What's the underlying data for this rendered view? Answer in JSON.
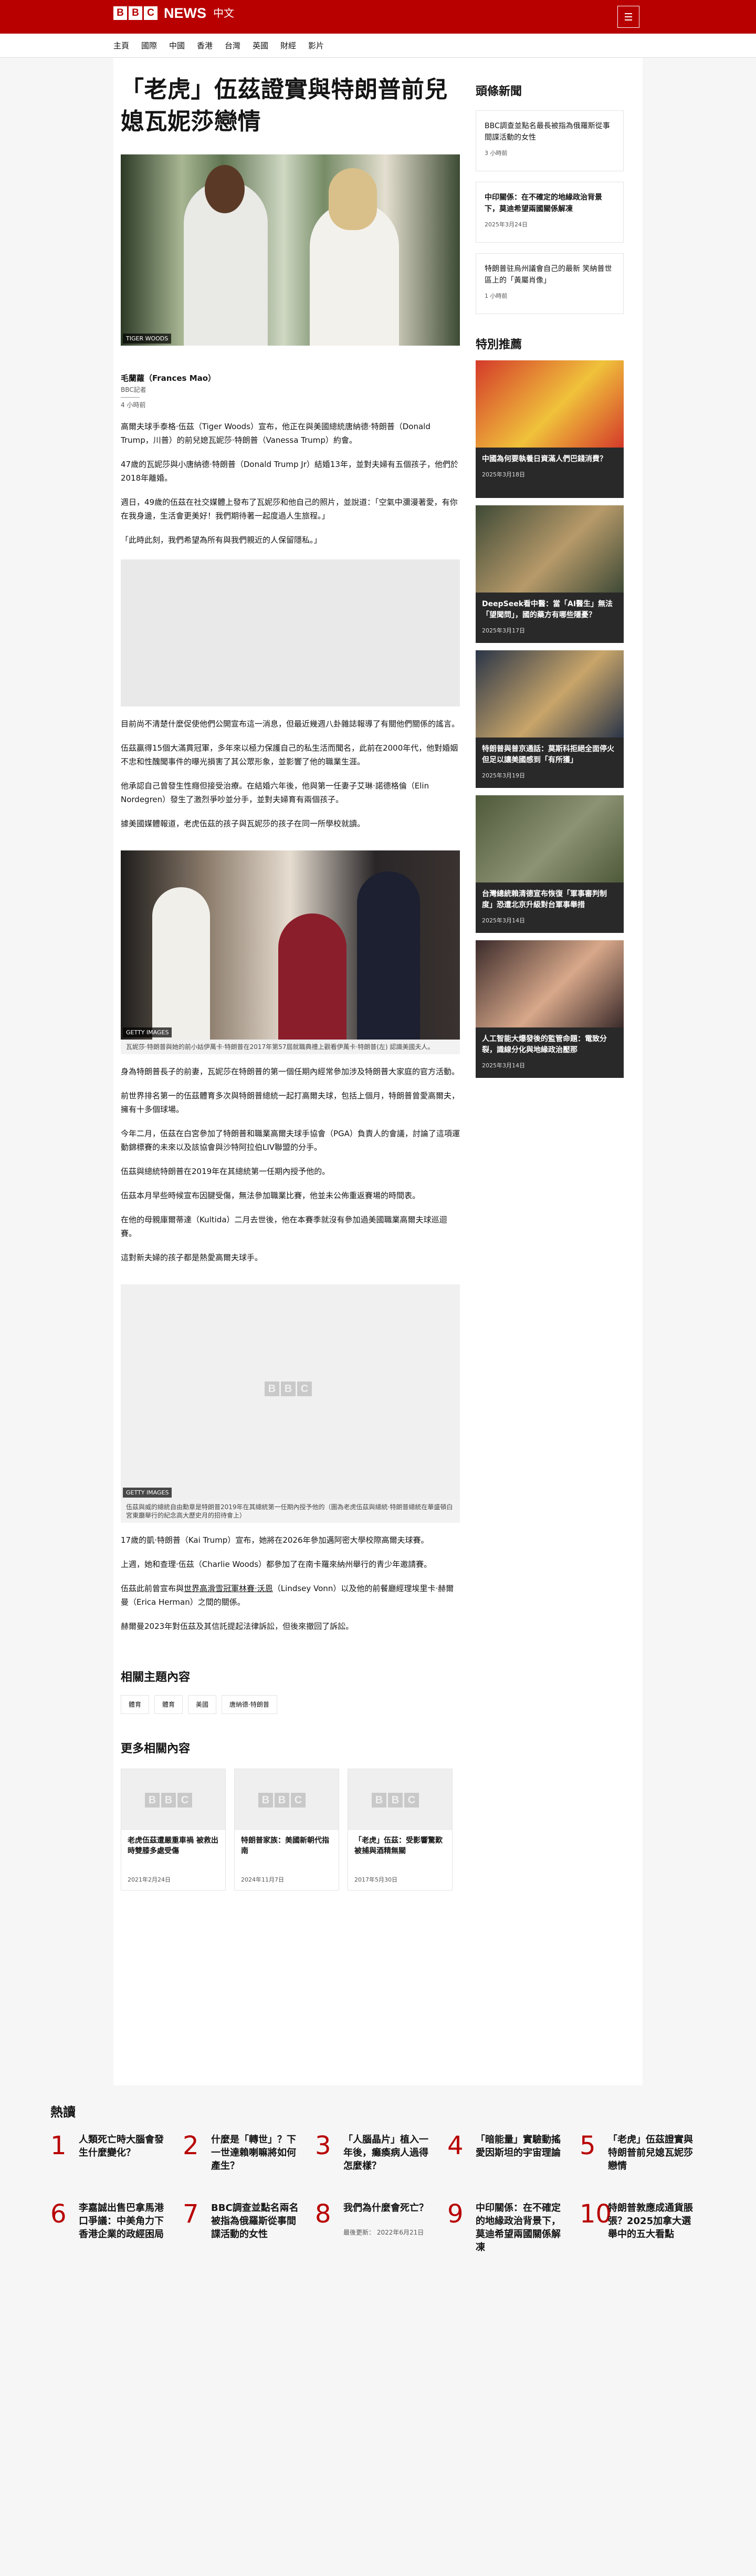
{
  "header": {
    "logo_letters": [
      "B",
      "B",
      "C"
    ],
    "logo_news": "NEWS",
    "logo_zh": "中文"
  },
  "nav": [
    "主頁",
    "國際",
    "中國",
    "香港",
    "台灣",
    "英國",
    "財經",
    "影片"
  ],
  "article": {
    "title": "「老虎」伍茲證實與特朗普前兒媳瓦妮莎戀情",
    "lead_tag": "TIGER WOODS",
    "author": "毛蘭蘿（Frances Mao）",
    "role": "BBC記者",
    "time": "4 小時前",
    "p1": "高爾夫球手泰格·伍茲（Tiger Woods）宣布，他正在與美國總統唐納德·特朗普（Donald Trump，川普）的前兒媳瓦妮莎·特朗普（Vanessa Trump）約會。",
    "p2": "47歲的瓦妮莎與小唐納德·特朗普（Donald Trump Jr）結婚13年，並對夫婦有五個孩子，他們於2018年離婚。",
    "p3": "週日，49歲的伍茲在社交媒體上發布了瓦妮莎和他自己的照片，並說道：「空氣中瀰漫著愛，有你在我身邊，生活會更美好！我們期待著一起度過人生旅程。」",
    "p4": "「此時此刻，我們希望為所有與我們親近的人保留隱私。」",
    "p5": "目前尚不清楚什麼促使他們公開宣布這一消息，但最近幾週八卦雜誌報導了有關他們關係的謠言。",
    "p6": "伍茲贏得15個大滿貫冠軍，多年來以極力保護自己的私生活而聞名，此前在2000年代，他對婚姻不忠和性醜聞事件的曝光損害了其公眾形象，並影響了他的職業生涯。",
    "p7": "他承認自己曾發生性癮但接受治療。在結婚六年後，他與第一任妻子艾琳·諾德格倫（Elin Nordegren）發生了激烈爭吵並分手，並對夫婦育有兩個孩子。",
    "p8": "據美國媒體報道，老虎伍茲的孩子與瓦妮莎的孩子在同一所學校就讀。",
    "img2_tag": "GETTY IMAGES",
    "img2_cap": "瓦妮莎·特朗普與她的前小姑伊萬卡·特朗普在2017年第57屆就職典禮上觀看伊萬卡·特朗普(左) 認識美國夫人。",
    "p9": "身為特朗普長子的前妻，瓦妮莎在特朗普的第一個任期內經常參加涉及特朗普大家庭的官方活動。",
    "p10": "前世界排名第一的伍茲體育多次與特朗普總統一起打高爾夫球，包括上個月，特朗普曾愛高爾夫，擁有十多個球場。",
    "p11": "今年二月，伍茲在白宮參加了特朗普和職業高爾夫球手協會（PGA）負責人的會議，討論了這項運動錦標賽的未來以及該協會與沙特阿拉伯LIV聯盟的分手。",
    "p12": "伍茲與總統特朗普在2019年在其總統第一任期內授予他的。",
    "p13": "伍茲本月早些時候宣布因腱受傷，無法參加職業比賽，他並未公佈重返賽場的時間表。",
    "p14": "在他的母親庫爾蒂達（Kultida）二月去世後，他在本賽季就沒有參加過美國職業高爾夫球巡迴賽。",
    "p15": "這對新夫婦的孩子都是熱愛高爾夫球手。",
    "img3_tag": "GETTY IMAGES",
    "img3_cap": "伍茲與威的總統自由勳章是特朗普2019年在其總統第一任期內授予他的（圖為老虎伍茲與總統·特朗普總統在華盛頓白宮東廳舉行的紀念高大歷史月的招待會上）",
    "p16": "17歲的凱·特朗普（Kai Trump）宣布，她將在2026年參加邁阿密大學校際高爾夫球賽。",
    "p17": "上週，她和查理·伍茲（Charlie Woods）都參加了在南卡羅來納州舉行的青少年邀請賽。",
    "p18_pre": "伍茲此前曾宣布與",
    "p18_link": "世界高滑雪冠軍林賽·沃恩",
    "p18_post": "（Lindsey Vonn）以及他的前餐廳經理埃里卡·赫爾曼（Erica Herman）之間的關係。",
    "p19": "赫爾曼2023年對伍茲及其信託提起法律訴訟，但後來撤回了訴訟。"
  },
  "related_topics": {
    "heading": "相關主題內容",
    "chips": [
      "體育",
      "體育",
      "美國",
      "唐納德·特朗普"
    ]
  },
  "more": {
    "heading": "更多相關內容",
    "cards": [
      {
        "title": "老虎伍茲遭嚴重車禍 被救出時雙膝多處受傷",
        "date": "2021年2月24日"
      },
      {
        "title": "特朗普家族：美國新朝代指南",
        "date": "2024年11月7日"
      },
      {
        "title": "「老虎」伍茲：受影響驚歎被捕與酒精無關",
        "date": "2017年5月30日"
      }
    ]
  },
  "sidebar": {
    "latest_heading": "頭條新聞",
    "latest": [
      {
        "title": "BBC調查並點名最長被指為俄羅斯從事間諜活動的女性",
        "date": "3 小時前"
      },
      {
        "title": "中印關係：在不確定的地緣政治背景下，莫迪希望兩國關係解凍",
        "date": "2025年3月24日"
      },
      {
        "title": "特朗普驻烏州議會自己的最新 笑納普世區上的「黃屬肖像」",
        "date": "1 小時前"
      }
    ],
    "featured_heading": "特別推薦",
    "featured": [
      {
        "title": "中國為何要執養日資滿人們巴錢消費？",
        "date": "2025年3月18日",
        "c1": "#d43a2a",
        "c2": "#f0c23b"
      },
      {
        "title": "DeepSeek看中醫：當「AI醫生」無法「望聞問」，國的藥方有哪些隱憂？",
        "date": "2025年3月17日",
        "c1": "#3e4a36",
        "c2": "#b79a6a"
      },
      {
        "title": "特朗普與普京通話：莫斯科拒絕全面停火 但足以讓美國感到「有所獲」",
        "date": "2025年3月19日",
        "c1": "#2a3548",
        "c2": "#c8a56a"
      },
      {
        "title": "台灣總統賴清德宣布恢復「軍事審判制度」恐遭北京升級對台軍事舉措",
        "date": "2025年3月14日",
        "c1": "#4e5a3a",
        "c2": "#8c9274"
      },
      {
        "title": "人工智能大爆發後的監管命題：電致分裂，識線分化與地緣政治壓那",
        "date": "2025年3月14日",
        "c1": "#3a2a2a",
        "c2": "#d8a88a"
      }
    ]
  },
  "popular": {
    "heading": "熱讀",
    "items": [
      {
        "n": "1",
        "t": "人類死亡時大腦會發生什麼變化？",
        "d": ""
      },
      {
        "n": "2",
        "t": "什麼是「轉世」？下一世達賴喇嘛將如何產生？",
        "d": ""
      },
      {
        "n": "3",
        "t": "「人腦晶片」植入一年後，癱瘓病人過得怎麼樣？",
        "d": ""
      },
      {
        "n": "4",
        "t": "「暗能量」實驗動搖愛因斯坦的宇宙理論",
        "d": ""
      },
      {
        "n": "5",
        "t": "「老虎」伍茲證實與特朗普前兒媳瓦妮莎戀情",
        "d": ""
      },
      {
        "n": "6",
        "t": "李嘉誠出售巴拿馬港口爭議：中美角力下香港企業的政經困局",
        "d": ""
      },
      {
        "n": "7",
        "t": "BBC調查並點名兩名被指為俄羅斯從事間諜活動的女性",
        "d": ""
      },
      {
        "n": "8",
        "t": "我們為什麼會死亡？",
        "d": "最後更新： 2022年6月21日"
      },
      {
        "n": "9",
        "t": "中印關係：在不確定的地緣政治背景下，莫迪希望兩國關係解凍",
        "d": ""
      },
      {
        "n": "10",
        "t": "特朗普敦應成通貨脹張？2025加拿大選舉中的五大看點",
        "d": ""
      }
    ]
  }
}
